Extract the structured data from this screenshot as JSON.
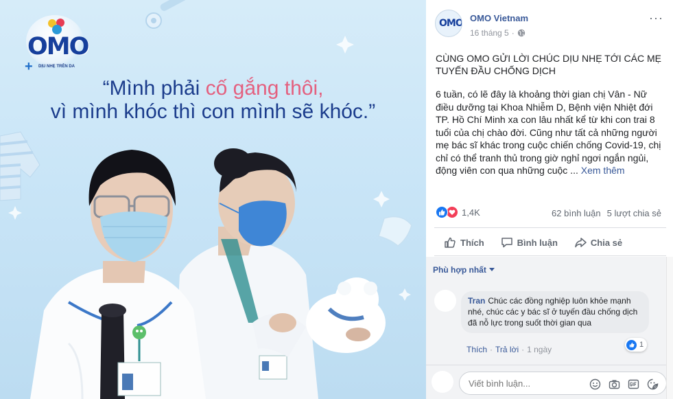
{
  "image": {
    "brand_logo": "OMO",
    "brand_tagline": "DỊU NHẸ TRÊN DA",
    "quote_line1_before": "“Mình phải ",
    "quote_line1_highlight": "cố gắng thôi,",
    "quote_line2": "vì mình khóc thì con mình sẽ khóc.”",
    "colors": {
      "quote_blue": "#1b3c8c",
      "quote_pink": "#e4607f",
      "background": "#cbe5f7"
    }
  },
  "post": {
    "page_name": "OMO Vietnam",
    "avatar_text": "OMO",
    "date": "16 tháng 5",
    "separator": "·",
    "audience_icon": "globe-icon",
    "more_icon": "more-icon",
    "more_label": "···",
    "title": "CÙNG OMO GỬI LỜI CHÚC DỊU NHẸ TỚI CÁC MẸ TUYẾN ĐẦU CHỐNG DỊCH",
    "body": "6 tuần, có lẽ đây là khoảng thời gian chị Vân - Nữ điều dưỡng tại Khoa Nhiễm D, Bệnh viện Nhiệt đới TP. Hồ Chí Minh xa con lâu nhất kể từ khi con trai 8 tuổi của chị chào đời. Cũng như tất cả những người mẹ bác sĩ khác trong cuộc chiến chống Covid-19, chị chỉ có thể tranh thủ trong giờ nghỉ ngơi ngắn ngủi, động viên con qua những cuộc ...",
    "see_more": "Xem thêm",
    "reactions_count": "1,4K",
    "comments_count": "62 bình luận",
    "shares_count": "5 lượt chia sẻ"
  },
  "actions": {
    "like": "Thích",
    "comment": "Bình luận",
    "share": "Chia sẻ"
  },
  "comments": {
    "filter_label": "Phù hợp nhất",
    "items": [
      {
        "author": "Tran",
        "text": "Chúc các đồng nghiệp luôn khỏe mạnh nhé, chúc các y bác sĩ ở tuyến đầu chống dịch đã nỗ lực trong suốt thời gian qua",
        "reaction_count": "1",
        "like_label": "Thích",
        "reply_label": "Trả lời",
        "time": "1 ngày",
        "dot": "·"
      }
    ],
    "compose_placeholder": "Viết bình luận...",
    "compose_icons": [
      "emoji-icon",
      "camera-icon",
      "gif-icon",
      "sticker-icon"
    ]
  },
  "colors": {
    "link_blue": "#385898",
    "fb_blue": "#1877f2",
    "love_red": "#f33e58",
    "secondary_text": "#606770"
  }
}
